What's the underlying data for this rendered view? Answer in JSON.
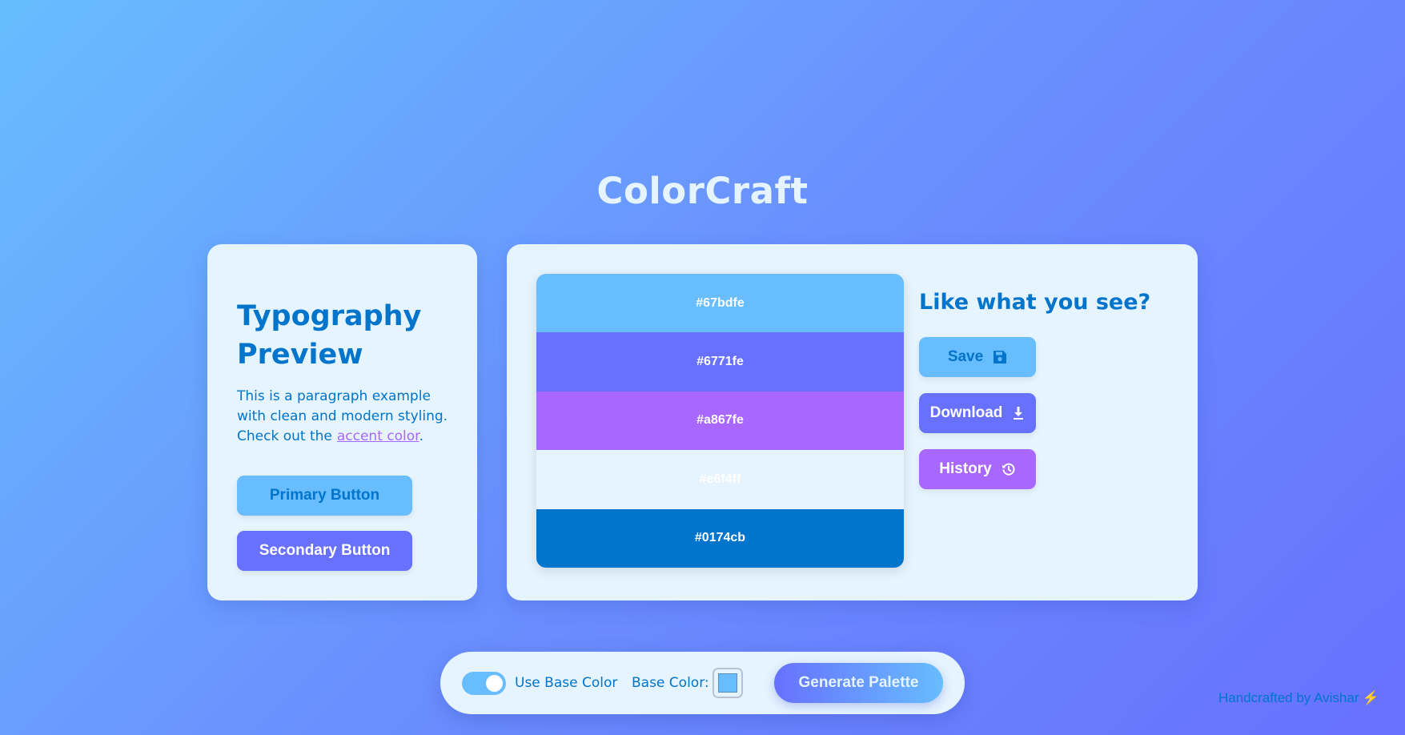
{
  "app": {
    "title": "ColorCraft"
  },
  "typography": {
    "heading": "Typography Preview",
    "paragraph": "This is a paragraph example with clean and modern styling. Check out the",
    "link_text": "accent color",
    "paragraph_end": ".",
    "primary_button": "Primary Button",
    "secondary_button": "Secondary Button"
  },
  "palette": {
    "swatches": [
      {
        "hex": "#67bdfe",
        "label": "#67bdfe",
        "text_color": "#ffffff"
      },
      {
        "hex": "#6771fe",
        "label": "#6771fe",
        "text_color": "#ffffff"
      },
      {
        "hex": "#a867fe",
        "label": "#a867fe",
        "text_color": "#ffffff"
      },
      {
        "hex": "#e6f4ff",
        "label": "#e6f4ff",
        "text_color": "#ffffff"
      },
      {
        "hex": "#0174cb",
        "label": "#0174cb",
        "text_color": "#ffffff"
      }
    ],
    "cta_heading": "Like what you see?",
    "save_label": "Save",
    "download_label": "Download",
    "history_label": "History",
    "save_icon": "floppy-disk-icon",
    "download_icon": "download-icon",
    "history_icon": "history-icon"
  },
  "toolbar": {
    "use_base_color_label": "Use Base Color",
    "use_base_color_on": true,
    "base_color_label": "Base Color:",
    "base_color_value": "#67bdfe",
    "generate_label": "Generate Palette"
  },
  "footer": {
    "credit": "Handcrafted by Avishar",
    "credit_icon": "lightning-bolt-icon"
  },
  "colors": {
    "primary": "#67bdfe",
    "secondary": "#6771fe",
    "accent": "#a867fe",
    "background": "#e6f4ff",
    "text": "#0174cb"
  }
}
